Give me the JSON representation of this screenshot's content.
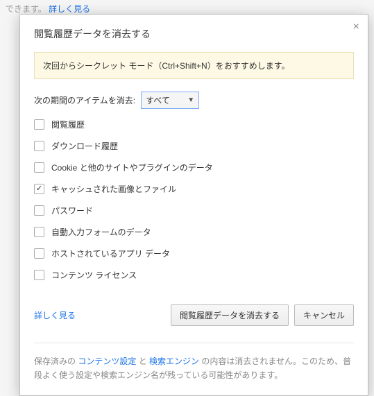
{
  "bg": {
    "line1_suffix": "",
    "line2_prefix": "できます。",
    "line2_link": "詳しく見る"
  },
  "dialog": {
    "title": "閲覧履歴データを消去する",
    "banner": "次回からシークレット モード（Ctrl+Shift+N）をおすすめします。",
    "period_label": "次の期間のアイテムを消去:",
    "period_value": "すべて",
    "checkboxes": [
      {
        "label": "閲覧履歴",
        "checked": false
      },
      {
        "label": "ダウンロード履歴",
        "checked": false
      },
      {
        "label": "Cookie と他のサイトやプラグインのデータ",
        "checked": false
      },
      {
        "label": "キャッシュされた画像とファイル",
        "checked": true
      },
      {
        "label": "パスワード",
        "checked": false
      },
      {
        "label": "自動入力フォームのデータ",
        "checked": false
      },
      {
        "label": "ホストされているアプリ データ",
        "checked": false
      },
      {
        "label": "コンテンツ ライセンス",
        "checked": false
      }
    ],
    "learn_more": "詳しく見る",
    "clear_button": "閲覧履歴データを消去する",
    "cancel_button": "キャンセル",
    "footer": {
      "p1": "保存済みの ",
      "link1": "コンテンツ設定",
      "p2": " と ",
      "link2": "検索エンジン",
      "p3": " の内容は消去されません。このため、普段よく使う設定や検索エンジン名が残っている可能性があります。"
    }
  }
}
